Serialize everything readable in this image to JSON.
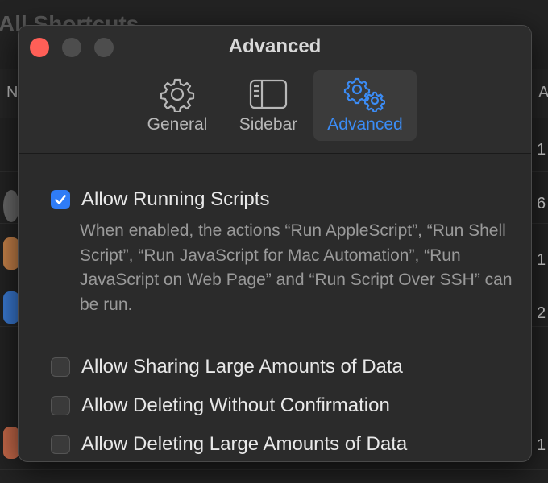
{
  "background": {
    "title": "All Shortcuts",
    "header_left": "N",
    "header_right": "A",
    "row_numbers": [
      "1",
      "6",
      "1",
      "2",
      "1"
    ]
  },
  "window": {
    "title": "Advanced",
    "tabs": [
      {
        "label": "General",
        "icon": "gear-icon"
      },
      {
        "label": "Sidebar",
        "icon": "sidebar-icon"
      },
      {
        "label": "Advanced",
        "icon": "gears-icon",
        "active": true
      }
    ]
  },
  "settings": {
    "allow_running_scripts": {
      "label": "Allow Running Scripts",
      "checked": true,
      "description": "When enabled, the actions “Run AppleScript”, “Run Shell Script”, “Run JavaScript for Mac Automation”, “Run JavaScript on Web Page” and “Run Script Over SSH” can be run."
    },
    "allow_sharing_large": {
      "label": "Allow Sharing Large Amounts of Data",
      "checked": false
    },
    "allow_deleting_without_confirmation": {
      "label": "Allow Deleting Without Confirmation",
      "checked": false
    },
    "allow_deleting_large": {
      "label": "Allow Deleting Large Amounts of Data",
      "checked": false
    }
  },
  "colors": {
    "accent": "#3b8cf6",
    "close_button": "#ff5f57",
    "window_bg": "#2b2b2b"
  }
}
